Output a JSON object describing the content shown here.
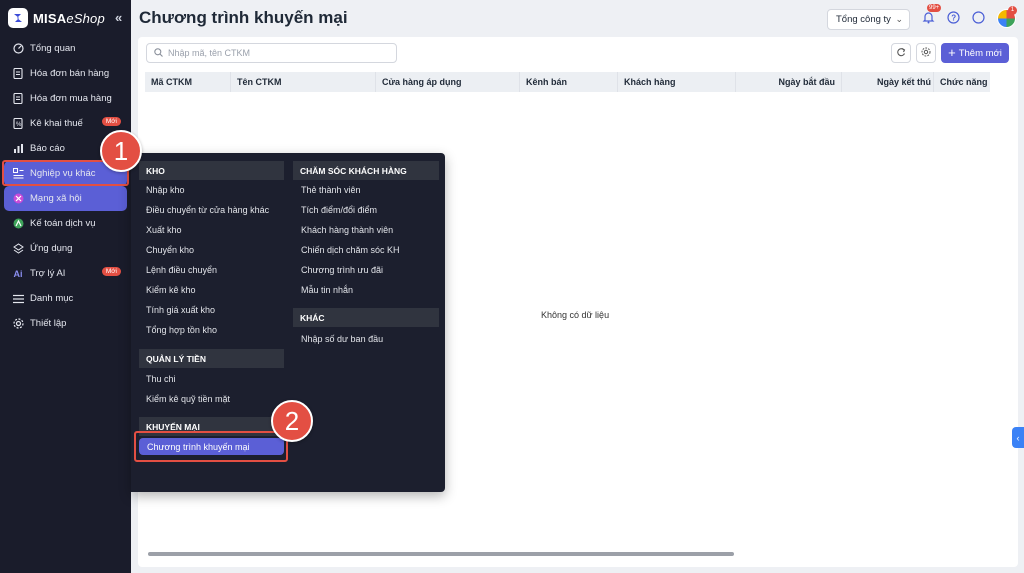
{
  "app": {
    "logo_brand": "MISA",
    "logo_product": "eShop",
    "collapse_icon": "«"
  },
  "sidebar": {
    "items": [
      {
        "label": "Tổng quan",
        "icon": "dashboard-icon"
      },
      {
        "label": "Hóa đơn bán hàng",
        "icon": "invoice-icon"
      },
      {
        "label": "Hóa đơn mua hàng",
        "icon": "purchase-invoice-icon"
      },
      {
        "label": "Kê khai thuế",
        "icon": "tax-icon",
        "badge": "Mới"
      },
      {
        "label": "Báo cáo",
        "icon": "report-icon"
      },
      {
        "label": "Nghiệp vụ khác",
        "icon": "operations-icon"
      },
      {
        "label": "Mạng xã hội",
        "icon": "social-icon"
      },
      {
        "label": "Kế toán dịch vụ",
        "icon": "accounting-icon"
      },
      {
        "label": "Ứng dụng",
        "icon": "apps-icon"
      },
      {
        "label": "Trợ lý AI",
        "icon": "ai-icon",
        "badge": "Mới"
      },
      {
        "label": "Danh mục",
        "icon": "list-icon"
      },
      {
        "label": "Thiết lập",
        "icon": "settings-icon"
      }
    ]
  },
  "header": {
    "title": "Chương trình khuyến mại",
    "company": "Tổng công ty",
    "notification_count": "99+",
    "avatar_badge": "1"
  },
  "toolbar": {
    "search_placeholder": "Nhập mã, tên CTKM",
    "add_label": "Thêm mới"
  },
  "table": {
    "columns": [
      "Mã CTKM",
      "Tên CTKM",
      "Cửa hàng áp dụng",
      "Kênh bán",
      "Khách hàng",
      "Ngày bắt đầu",
      "Ngày kết thú",
      "Chức năng"
    ],
    "empty_text": "Không có dữ liệu"
  },
  "menu": {
    "left": [
      {
        "header": "KHO",
        "items": [
          "Nhập kho",
          "Điều chuyển từ cửa hàng khác",
          "Xuất kho",
          "Chuyển kho",
          "Lệnh điều chuyển",
          "Kiểm kê kho",
          "Tính giá xuất kho",
          "Tổng hợp tồn kho"
        ]
      },
      {
        "header": "QUẢN LÝ TIỀN",
        "items": [
          "Thu chi",
          "Kiểm kê quỹ tiền mặt"
        ]
      },
      {
        "header": "KHUYẾN MẠI",
        "items": [
          "Chương trình khuyến mại"
        ]
      }
    ],
    "right": [
      {
        "header": "CHĂM SÓC KHÁCH HÀNG",
        "items": [
          "Thẻ thành viên",
          "Tích điểm/đổi điểm",
          "Khách hàng thành viên",
          "Chiến dịch chăm sóc KH",
          "Chương trình ưu đãi",
          "Mẫu tin nhắn"
        ]
      },
      {
        "header": "KHÁC",
        "items": [
          "Nhập số dư ban đầu"
        ]
      }
    ]
  },
  "callouts": {
    "step1": "1",
    "step2": "2"
  },
  "colors": {
    "sidebar_bg": "#1a1c2b",
    "accent": "#5b5fd6",
    "highlight": "#e34f43"
  }
}
